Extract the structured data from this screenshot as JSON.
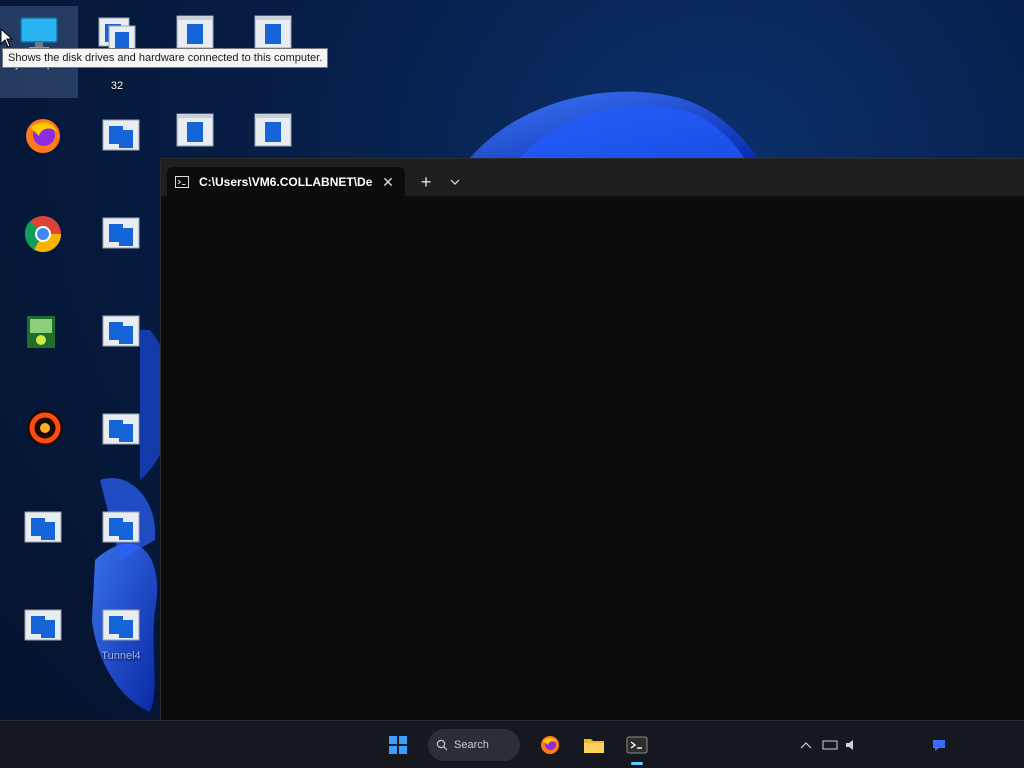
{
  "tooltip": {
    "text": "Shows the disk drives and hardware connected to this computer."
  },
  "desktop": {
    "icons": [
      {
        "id": "my-computer",
        "icon": "monitor-icon",
        "label": "My Computer"
      },
      {
        "id": "app-32",
        "icon": "window-app-icon",
        "label": "32"
      },
      {
        "id": "app-r1c3",
        "icon": "window-app-icon",
        "label": ""
      },
      {
        "id": "app-r1c4",
        "icon": "window-app-icon",
        "label": ""
      },
      {
        "id": "firefox",
        "icon": "firefox-icon",
        "label": ""
      },
      {
        "id": "app-r2c2",
        "icon": "window-app-icon",
        "label": ""
      },
      {
        "id": "app-r2c3",
        "icon": "window-app-icon",
        "label": ""
      },
      {
        "id": "app-r2c4",
        "icon": "window-app-icon",
        "label": ""
      },
      {
        "id": "chrome",
        "icon": "chrome-icon",
        "label": ""
      },
      {
        "id": "app-r3c2",
        "icon": "window-app-icon",
        "label": ""
      },
      {
        "id": "cert-app",
        "icon": "certificate-icon",
        "label": ""
      },
      {
        "id": "app-r4c2",
        "icon": "window-app-icon",
        "label": ""
      },
      {
        "id": "orange-app",
        "icon": "orange-ring-icon",
        "label": ""
      },
      {
        "id": "app-r5c2",
        "icon": "window-app-icon",
        "label": ""
      },
      {
        "id": "app-r6c1",
        "icon": "window-app-icon",
        "label": ""
      },
      {
        "id": "app-r6c2",
        "icon": "window-app-icon",
        "label": ""
      },
      {
        "id": "app-r7c1",
        "icon": "window-app-icon",
        "label": ""
      },
      {
        "id": "tunnel4",
        "icon": "window-app-icon",
        "label": "Tunnel4"
      }
    ]
  },
  "terminal": {
    "tab_title": "C:\\Users\\VM6.COLLABNET\\De",
    "tab_icon": "terminal-icon",
    "close_glyph": "✕",
    "new_tab_glyph": "+",
    "dropdown_icon": "chevron-down-icon"
  },
  "taskbar": {
    "search_label": "Search",
    "items": [
      "start-icon",
      "search-icon",
      "firefox-icon",
      "folder-icon",
      "terminal-icon"
    ],
    "accent": "#60cdff"
  },
  "colors": {
    "wallpaper": "#061a3d",
    "bloom": "#1a4fe0",
    "terminal_bg": "#0c0c0c",
    "titlebar_bg": "#1f1f1f",
    "taskbar_bg": "#15191f"
  }
}
